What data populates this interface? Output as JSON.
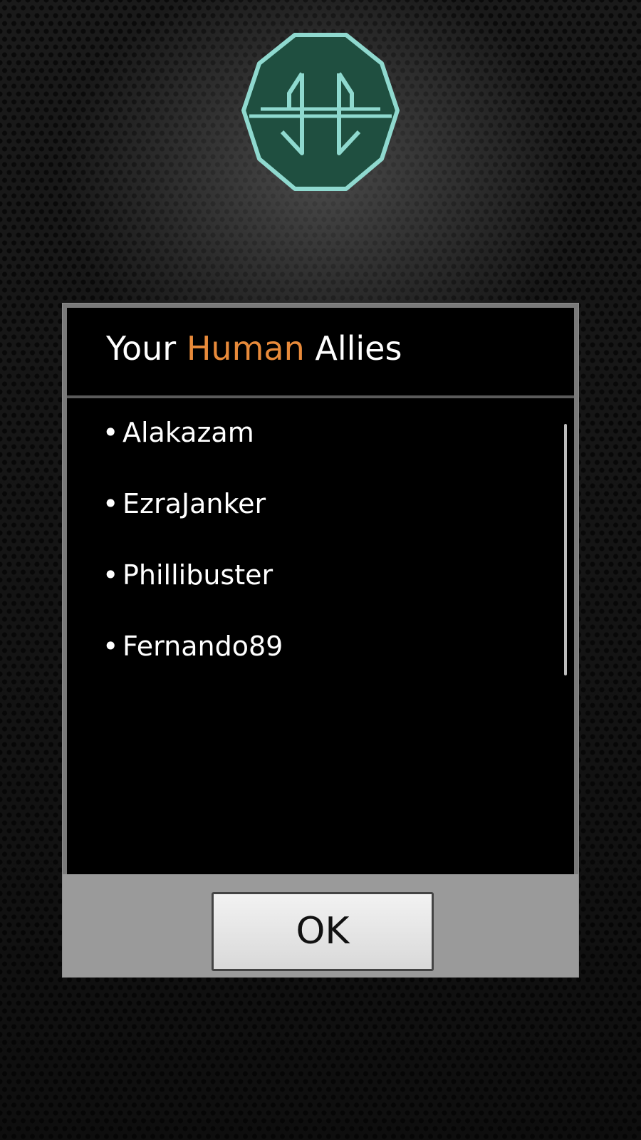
{
  "logo": {
    "icon": "octagon-emblem-icon",
    "fill_color": "#1f4f40",
    "stroke_color": "#8fd9cf"
  },
  "dialog": {
    "title_prefix": "Your ",
    "title_accent": "Human",
    "title_suffix": " Allies",
    "accent_color": "#e88a3a",
    "allies": [
      "Alakazam",
      "EzraJanker",
      "Phillibuster",
      "Fernando89"
    ],
    "bullet": "•",
    "ok_label": "OK"
  }
}
